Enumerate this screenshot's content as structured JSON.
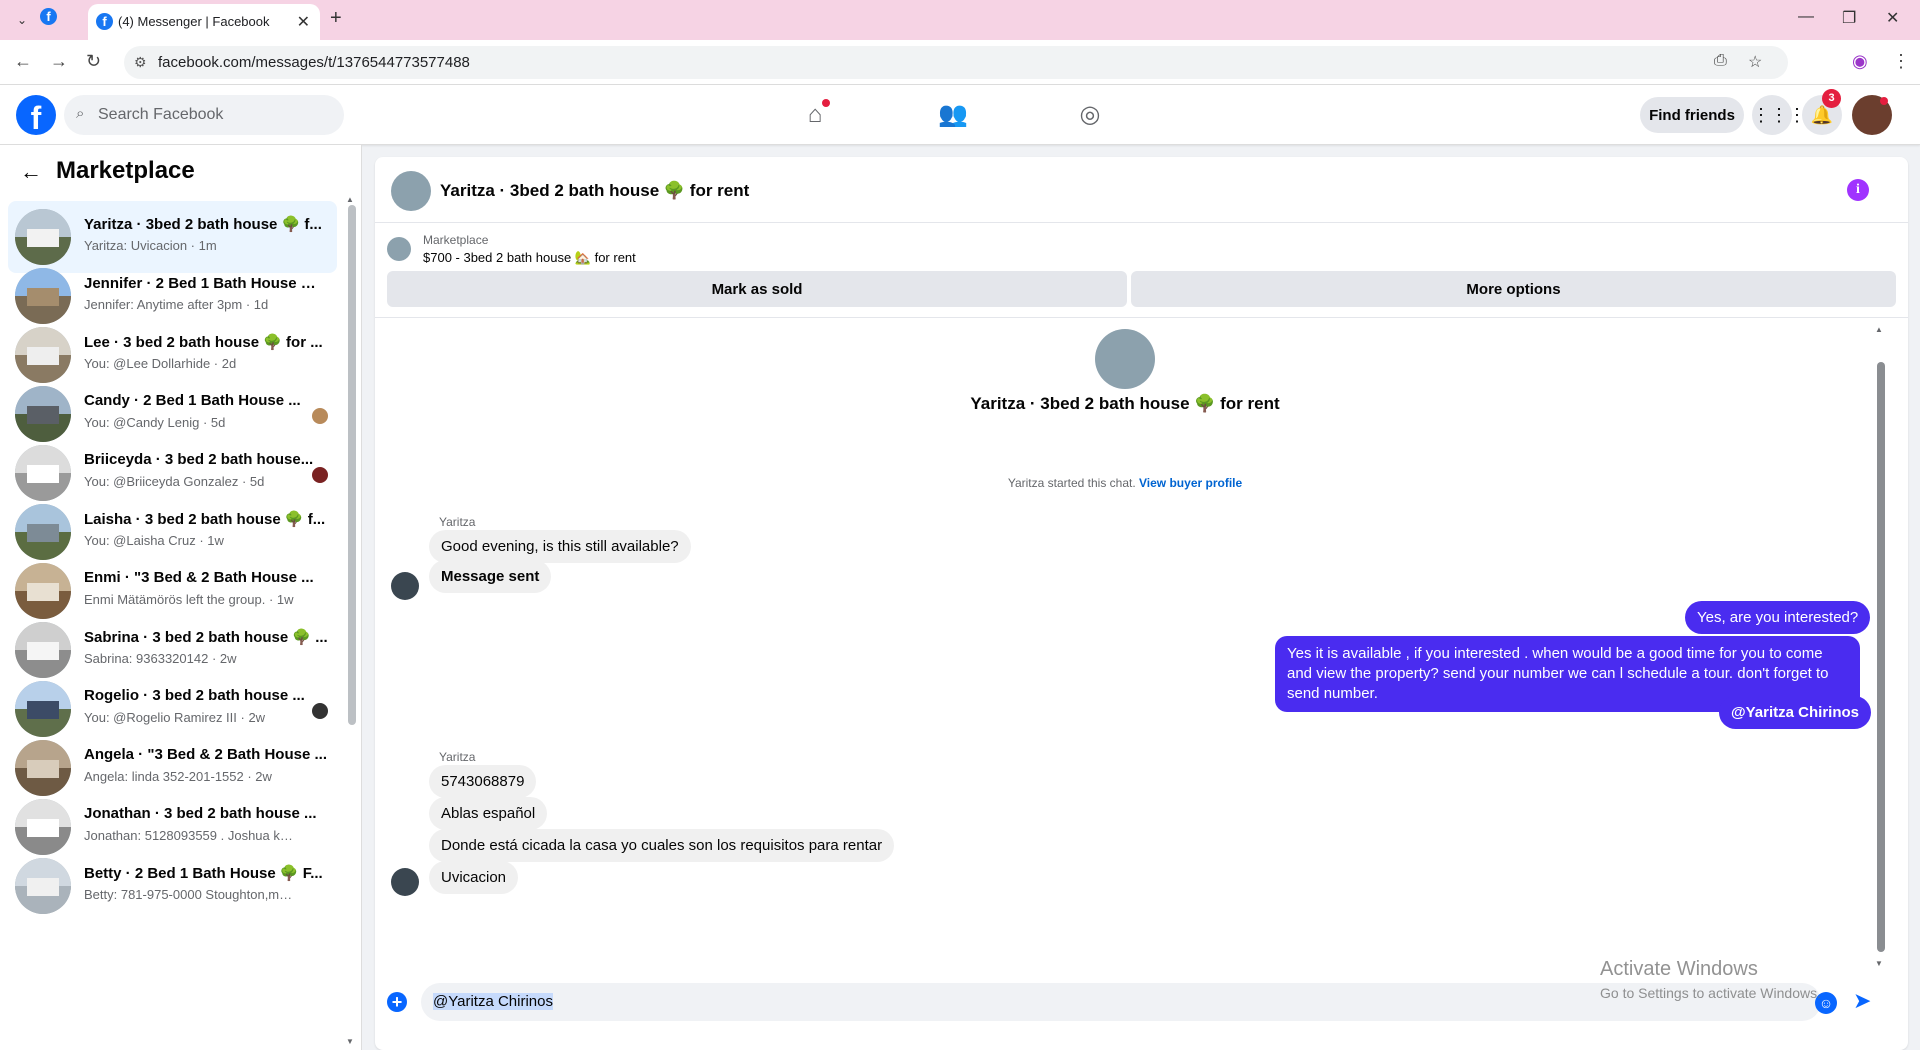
{
  "browser": {
    "tab_title": "(4) Messenger | Facebook",
    "url": "facebook.com/messages/t/1376544773577488",
    "new_tab_glyph": "+",
    "close_glyph": "✕"
  },
  "header": {
    "search_placeholder": "Search Facebook",
    "find_friends_label": "Find friends",
    "notification_count": "3"
  },
  "sidebar": {
    "title": "Marketplace",
    "conversations": [
      {
        "name": "Yaritza · 3bed 2 bath house 🌳 f...",
        "preview": "Yaritza: Uvicacion · 1m",
        "active": true
      },
      {
        "name": "Jennifer · 2 Bed 1 Bath House 🌳 ...",
        "preview": "Jennifer: Anytime after 3pm · 1d"
      },
      {
        "name": "Lee · 3 bed 2 bath house 🌳 for ...",
        "preview": "You: @Lee Dollarhide · 2d"
      },
      {
        "name": "Candy · 2 Bed 1 Bath House ...",
        "preview": "You: @Candy Lenig · 5d"
      },
      {
        "name": "Briiceyda · 3 bed 2 bath house...",
        "preview": "You: @Briiceyda Gonzalez · 5d"
      },
      {
        "name": "Laisha · 3 bed 2 bath house 🌳 f...",
        "preview": "You: @Laisha Cruz · 1w"
      },
      {
        "name": "Enmi · \"3 Bed & 2 Bath House ...",
        "preview": "Enmi Mätämörös left the group. · 1w"
      },
      {
        "name": "Sabrina · 3 bed 2 bath house 🌳 ...",
        "preview": "Sabrina: 9363320142 · 2w"
      },
      {
        "name": "Rogelio · 3 bed 2 bath house ...",
        "preview": "You: @Rogelio Ramirez III · 2w"
      },
      {
        "name": "Angela · \"3 Bed & 2 Bath House ...",
        "preview": "Angela: linda 352-201-1552 · 2w"
      },
      {
        "name": "Jonathan · 3 bed 2 bath house ...",
        "preview": "Jonathan: 5128093559 . Joshua kra... · 2w"
      },
      {
        "name": "Betty · 2 Bed 1 Bath House 🌳 F...",
        "preview": "Betty: 781-975-0000 Stoughton,ma · 2w"
      }
    ]
  },
  "chat": {
    "title": "Yaritza · 3bed 2 bath house 🌳 for rent",
    "marketplace_label": "Marketplace",
    "listing": "$700 - 3bed 2 bath house 🏡 for rent",
    "mark_sold_label": "Mark as sold",
    "more_options_label": "More options",
    "started_text": "Yaritza started this chat.",
    "view_buyer_profile": "View buyer profile",
    "messages": [
      {
        "sender": "Yaritza",
        "text": "Good evening, is this still available?",
        "dir": "in"
      },
      {
        "text": "Message sent",
        "dir": "in"
      },
      {
        "text": "Yes, are you interested?",
        "dir": "out"
      },
      {
        "text": "Yes it is available , if you interested . when would be  a good time for you to come and view the  property? send your number we can l schedule  a tour. don't forget to send  number.",
        "dir": "out"
      },
      {
        "text": "@Yaritza Chirinos",
        "dir": "out"
      },
      {
        "sender": "Yaritza",
        "text": "5743068879",
        "dir": "in"
      },
      {
        "text": "Ablas español",
        "dir": "in"
      },
      {
        "text": "Donde está cicada la casa yo cuales son los requisitos para rentar",
        "dir": "in"
      },
      {
        "text": "Uvicacion",
        "dir": "in"
      }
    ],
    "compose_text": "@Yaritza Chirinos"
  },
  "watermark": {
    "line1": "Activate Windows",
    "line2": "Go to Settings to activate Windows."
  },
  "colors": {
    "facebook_blue": "#0866ff",
    "outgoing_bubble": "#4a2cf0",
    "active_conversation": "#ebf5ff",
    "tab_strip": "#f6d3e4"
  },
  "icons": [
    "chevron-down-icon",
    "facebook-icon",
    "close-icon",
    "plus-icon",
    "back-icon",
    "forward-icon",
    "reload-icon",
    "site-info-icon",
    "install-icon",
    "star-icon",
    "profile-icon",
    "menu-icon",
    "search-icon",
    "home-icon",
    "friends-icon",
    "groups-icon",
    "apps-grid-icon",
    "bell-icon",
    "info-icon",
    "emoji-icon",
    "send-icon"
  ]
}
